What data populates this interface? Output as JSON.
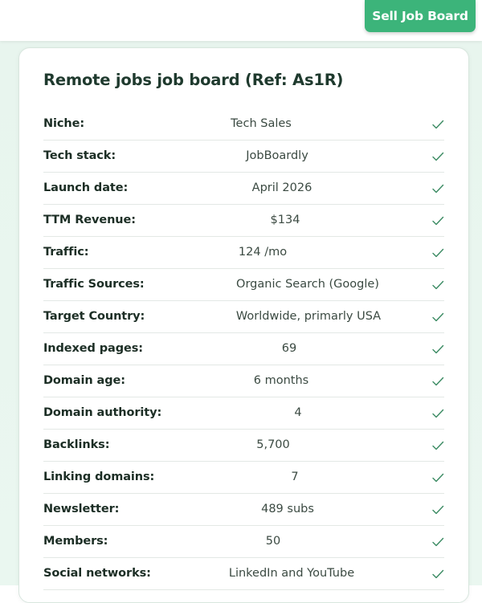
{
  "header": {
    "sell_button_label": "Sell Job Board"
  },
  "card": {
    "title": "Remote jobs job board (Ref: As1R)",
    "rows": [
      {
        "label": "Niche:",
        "value": "Tech Sales"
      },
      {
        "label": "Tech stack:",
        "value": "JobBoardly"
      },
      {
        "label": "Launch date:",
        "value": "April 2026"
      },
      {
        "label": "TTM Revenue:",
        "value": "$134"
      },
      {
        "label": "Traffic:",
        "value": "124 /mo"
      },
      {
        "label": "Traffic Sources:",
        "value": "Organic Search (Google)"
      },
      {
        "label": "Target Country:",
        "value": "Worldwide, primarly USA"
      },
      {
        "label": "Indexed pages:",
        "value": "69"
      },
      {
        "label": "Domain age:",
        "value": "6 months"
      },
      {
        "label": "Domain authority:",
        "value": "4"
      },
      {
        "label": "Backlinks:",
        "value": "5,700"
      },
      {
        "label": "Linking domains:",
        "value": "7"
      },
      {
        "label": "Newsletter:",
        "value": "489 subs"
      },
      {
        "label": "Members:",
        "value": "50"
      },
      {
        "label": "Social networks:",
        "value": "LinkedIn and YouTube"
      }
    ]
  },
  "colors": {
    "accent": "#3cb47a",
    "check": "#3a8a62",
    "background": "#e8f5ee"
  },
  "icons": {
    "row_status": "check-icon"
  }
}
